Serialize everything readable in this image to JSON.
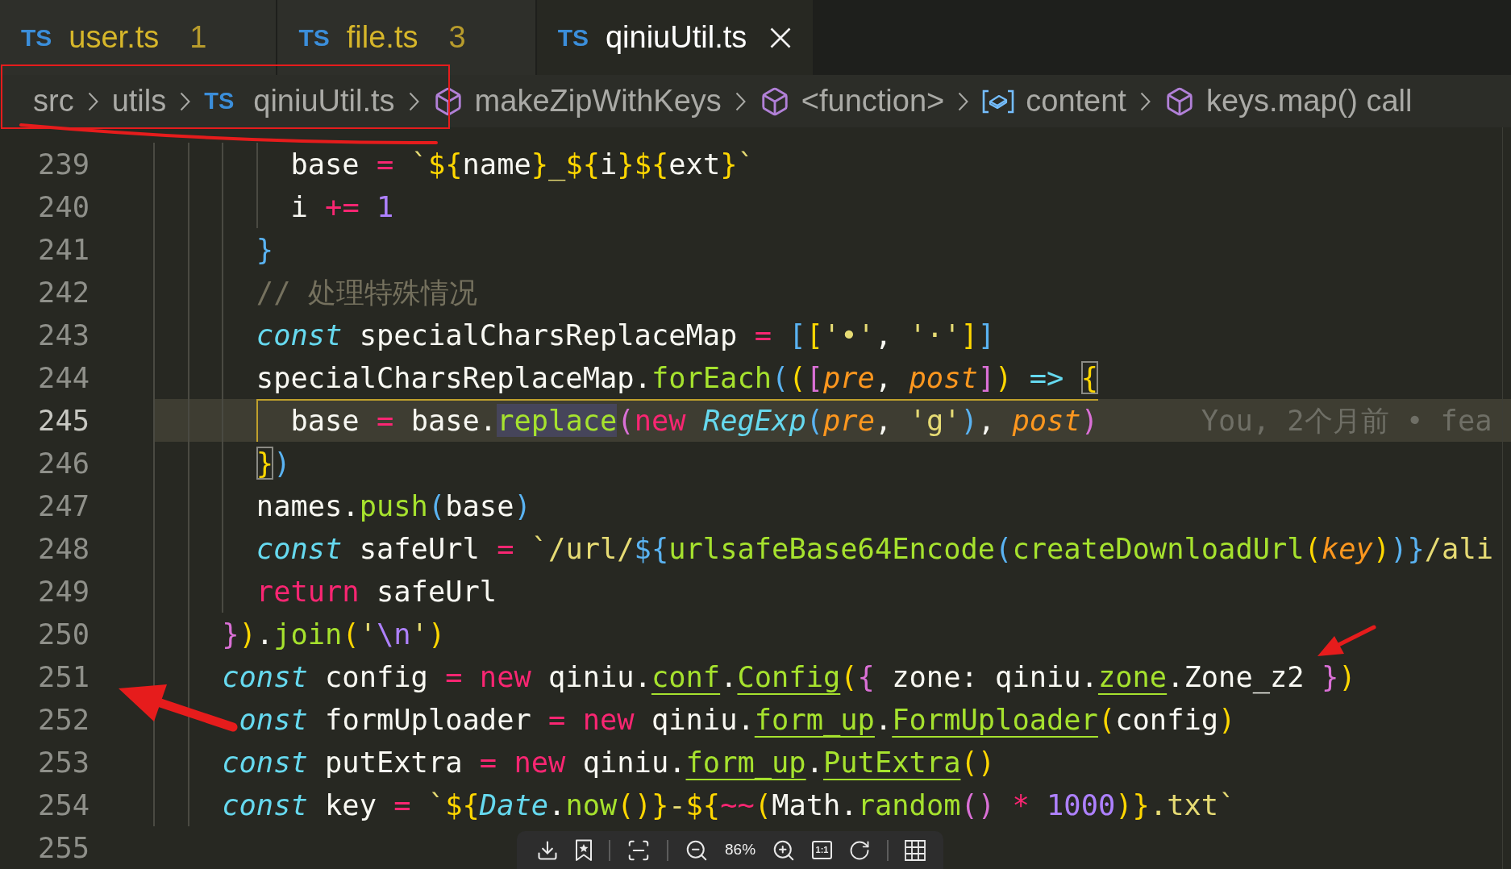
{
  "tabs": [
    {
      "lang": "TS",
      "label": "user.ts",
      "problems": "1",
      "warning": true,
      "selected": false
    },
    {
      "lang": "TS",
      "label": "file.ts",
      "problems": "3",
      "warning": true,
      "selected": false
    },
    {
      "lang": "TS",
      "label": "qiniuUtil.ts",
      "warning": false,
      "selected": true
    }
  ],
  "breadcrumbs": [
    {
      "kind": "folder",
      "label": "src"
    },
    {
      "kind": "folder",
      "label": "utils"
    },
    {
      "kind": "file",
      "lang": "TS",
      "label": "qiniuUtil.ts"
    },
    {
      "kind": "symbol",
      "label": "makeZipWithKeys"
    },
    {
      "kind": "symbol",
      "label": "<function>"
    },
    {
      "kind": "variable",
      "label": "content"
    },
    {
      "kind": "symbol",
      "label": "keys.map() call"
    }
  ],
  "editor": {
    "lines": [
      {
        "number": "239",
        "current": false,
        "tokens": [
          {
            "text": "        base ",
            "kind": "plain"
          },
          {
            "text": "= ",
            "kind": "operator"
          },
          {
            "text": "`",
            "kind": "string"
          },
          {
            "text": "${",
            "kind": "bracket1"
          },
          {
            "text": "name",
            "kind": "plain"
          },
          {
            "text": "}",
            "kind": "bracket1"
          },
          {
            "text": "_",
            "kind": "string"
          },
          {
            "text": "${",
            "kind": "bracket1"
          },
          {
            "text": "i",
            "kind": "plain"
          },
          {
            "text": "}${",
            "kind": "bracket1"
          },
          {
            "text": "ext",
            "kind": "plain"
          },
          {
            "text": "}",
            "kind": "bracket1"
          },
          {
            "text": "`",
            "kind": "string"
          }
        ]
      },
      {
        "number": "240",
        "current": false,
        "tokens": [
          {
            "text": "        i ",
            "kind": "plain"
          },
          {
            "text": "+= ",
            "kind": "operator"
          },
          {
            "text": "1",
            "kind": "number"
          }
        ]
      },
      {
        "number": "241",
        "current": false,
        "tokens": [
          {
            "text": "      }",
            "kind": "bracket3"
          }
        ]
      },
      {
        "number": "242",
        "current": false,
        "tokens": [
          {
            "text": "      // 处理特殊情况",
            "kind": "comment"
          }
        ]
      },
      {
        "number": "243",
        "current": false,
        "tokens": [
          {
            "text": "      const ",
            "kind": "storage"
          },
          {
            "text": "specialCharsReplaceMap ",
            "kind": "plain"
          },
          {
            "text": "= ",
            "kind": "operator"
          },
          {
            "text": "[",
            "kind": "bracket3"
          },
          {
            "text": "[",
            "kind": "bracket1"
          },
          {
            "text": "'•'",
            "kind": "string"
          },
          {
            "text": ", ",
            "kind": "plain"
          },
          {
            "text": "'·'",
            "kind": "string"
          },
          {
            "text": "]",
            "kind": "bracket1"
          },
          {
            "text": "]",
            "kind": "bracket3"
          }
        ]
      },
      {
        "number": "244",
        "current": false,
        "tokens": [
          {
            "text": "      specialCharsReplaceMap.",
            "kind": "plain"
          },
          {
            "text": "forEach",
            "kind": "function"
          },
          {
            "text": "(",
            "kind": "bracket3"
          },
          {
            "text": "(",
            "kind": "bracket1"
          },
          {
            "text": "[",
            "kind": "bracket2"
          },
          {
            "text": "pre",
            "kind": "param"
          },
          {
            "text": ", ",
            "kind": "plain"
          },
          {
            "text": "post",
            "kind": "param"
          },
          {
            "text": "]",
            "kind": "bracket2"
          },
          {
            "text": ") ",
            "kind": "bracket1"
          },
          {
            "text": "=> ",
            "kind": "arrow"
          },
          {
            "text": "{",
            "kind": "bracket1",
            "matched": true
          }
        ]
      },
      {
        "number": "245",
        "current": true,
        "tokens": [
          {
            "text": "        base ",
            "kind": "plain"
          },
          {
            "text": "= ",
            "kind": "operator"
          },
          {
            "text": "base.",
            "kind": "plain"
          },
          {
            "text": "replace",
            "kind": "function",
            "highlighted": true
          },
          {
            "text": "(",
            "kind": "bracket2"
          },
          {
            "text": "new ",
            "kind": "operator"
          },
          {
            "text": "RegExp",
            "kind": "class"
          },
          {
            "text": "(",
            "kind": "bracket3"
          },
          {
            "text": "pre",
            "kind": "param"
          },
          {
            "text": ", ",
            "kind": "plain"
          },
          {
            "text": "'g'",
            "kind": "string"
          },
          {
            "text": ")",
            "kind": "bracket3"
          },
          {
            "text": ", ",
            "kind": "plain"
          },
          {
            "text": "post",
            "kind": "param"
          },
          {
            "text": ")",
            "kind": "bracket2"
          }
        ],
        "blame": "You, 2个月前 • fea"
      },
      {
        "number": "246",
        "current": false,
        "tokens": [
          {
            "text": "      }",
            "kind": "bracket1",
            "matched": true
          },
          {
            "text": ")",
            "kind": "bracket3"
          }
        ]
      },
      {
        "number": "247",
        "current": false,
        "tokens": [
          {
            "text": "      names.",
            "kind": "plain"
          },
          {
            "text": "push",
            "kind": "function"
          },
          {
            "text": "(",
            "kind": "bracket3"
          },
          {
            "text": "base",
            "kind": "plain"
          },
          {
            "text": ")",
            "kind": "bracket3"
          }
        ]
      },
      {
        "number": "248",
        "current": false,
        "tokens": [
          {
            "text": "      const ",
            "kind": "storage"
          },
          {
            "text": "safeUrl ",
            "kind": "plain"
          },
          {
            "text": "= ",
            "kind": "operator"
          },
          {
            "text": "`/url/",
            "kind": "string"
          },
          {
            "text": "${",
            "kind": "bracket3"
          },
          {
            "text": "urlsafeBase64Encode",
            "kind": "function"
          },
          {
            "text": "(",
            "kind": "bracket3"
          },
          {
            "text": "createDownloadUrl",
            "kind": "function"
          },
          {
            "text": "(",
            "kind": "bracket1"
          },
          {
            "text": "key",
            "kind": "param"
          },
          {
            "text": ")",
            "kind": "bracket1"
          },
          {
            "text": ")}",
            "kind": "bracket3"
          },
          {
            "text": "/ali",
            "kind": "string"
          }
        ]
      },
      {
        "number": "249",
        "current": false,
        "tokens": [
          {
            "text": "      return ",
            "kind": "operator"
          },
          {
            "text": "safeUrl",
            "kind": "plain"
          }
        ]
      },
      {
        "number": "250",
        "current": false,
        "tokens": [
          {
            "text": "    }",
            "kind": "bracket2"
          },
          {
            "text": ")",
            "kind": "bracket1"
          },
          {
            "text": ".",
            "kind": "plain"
          },
          {
            "text": "join",
            "kind": "function"
          },
          {
            "text": "(",
            "kind": "bracket1"
          },
          {
            "text": "'",
            "kind": "string"
          },
          {
            "text": "\\n",
            "kind": "number"
          },
          {
            "text": "'",
            "kind": "string"
          },
          {
            "text": ")",
            "kind": "bracket1"
          }
        ]
      },
      {
        "number": "251",
        "current": false,
        "tokens": [
          {
            "text": "    const ",
            "kind": "storage"
          },
          {
            "text": "config ",
            "kind": "plain"
          },
          {
            "text": "= new ",
            "kind": "operator"
          },
          {
            "text": "qiniu.",
            "kind": "plain"
          },
          {
            "text": "conf",
            "kind": "function",
            "underlined": true
          },
          {
            "text": ".",
            "kind": "plain"
          },
          {
            "text": "Config",
            "kind": "function",
            "underlined": true
          },
          {
            "text": "(",
            "kind": "bracket1"
          },
          {
            "text": "{ ",
            "kind": "bracket2"
          },
          {
            "text": "zone: qiniu.",
            "kind": "plain"
          },
          {
            "text": "zone",
            "kind": "function",
            "underlined": true
          },
          {
            "text": ".Zone_z2 ",
            "kind": "plain"
          },
          {
            "text": "}",
            "kind": "bracket2"
          },
          {
            "text": ")",
            "kind": "bracket1"
          }
        ]
      },
      {
        "number": "252",
        "current": false,
        "tokens": [
          {
            "text": "     onst ",
            "kind": "storage"
          },
          {
            "text": "formUploader ",
            "kind": "plain"
          },
          {
            "text": "= new ",
            "kind": "operator"
          },
          {
            "text": "qiniu.",
            "kind": "plain"
          },
          {
            "text": "form_up",
            "kind": "function",
            "underlined": true
          },
          {
            "text": ".",
            "kind": "plain"
          },
          {
            "text": "FormUploader",
            "kind": "function",
            "underlined": true
          },
          {
            "text": "(",
            "kind": "bracket1"
          },
          {
            "text": "config",
            "kind": "plain"
          },
          {
            "text": ")",
            "kind": "bracket1"
          }
        ]
      },
      {
        "number": "253",
        "current": false,
        "tokens": [
          {
            "text": "    const ",
            "kind": "storage"
          },
          {
            "text": "putExtra ",
            "kind": "plain"
          },
          {
            "text": "= new ",
            "kind": "operator"
          },
          {
            "text": "qiniu.",
            "kind": "plain"
          },
          {
            "text": "form_up",
            "kind": "function",
            "underlined": true
          },
          {
            "text": ".",
            "kind": "plain"
          },
          {
            "text": "PutExtra",
            "kind": "function",
            "underlined": true
          },
          {
            "text": "()",
            "kind": "bracket1"
          }
        ]
      },
      {
        "number": "254",
        "current": false,
        "tokens": [
          {
            "text": "    const ",
            "kind": "storage"
          },
          {
            "text": "key ",
            "kind": "plain"
          },
          {
            "text": "= ",
            "kind": "operator"
          },
          {
            "text": "`",
            "kind": "string"
          },
          {
            "text": "${",
            "kind": "bracket1"
          },
          {
            "text": "Date",
            "kind": "class"
          },
          {
            "text": ".",
            "kind": "plain"
          },
          {
            "text": "now",
            "kind": "function"
          },
          {
            "text": "()}",
            "kind": "bracket1"
          },
          {
            "text": "-",
            "kind": "string"
          },
          {
            "text": "${",
            "kind": "bracket1"
          },
          {
            "text": "~~",
            "kind": "operator"
          },
          {
            "text": "(",
            "kind": "bracket1"
          },
          {
            "text": "Math.",
            "kind": "plain"
          },
          {
            "text": "random",
            "kind": "function"
          },
          {
            "text": "() ",
            "kind": "bracket2"
          },
          {
            "text": "* ",
            "kind": "operator"
          },
          {
            "text": "1000",
            "kind": "number"
          },
          {
            "text": ")}",
            "kind": "bracket1"
          },
          {
            "text": ".txt`",
            "kind": "string"
          }
        ]
      },
      {
        "number": "255",
        "current": false
      }
    ]
  },
  "viewer_toolbar": {
    "zoom_level": "86%",
    "actual_size": "1:1"
  }
}
